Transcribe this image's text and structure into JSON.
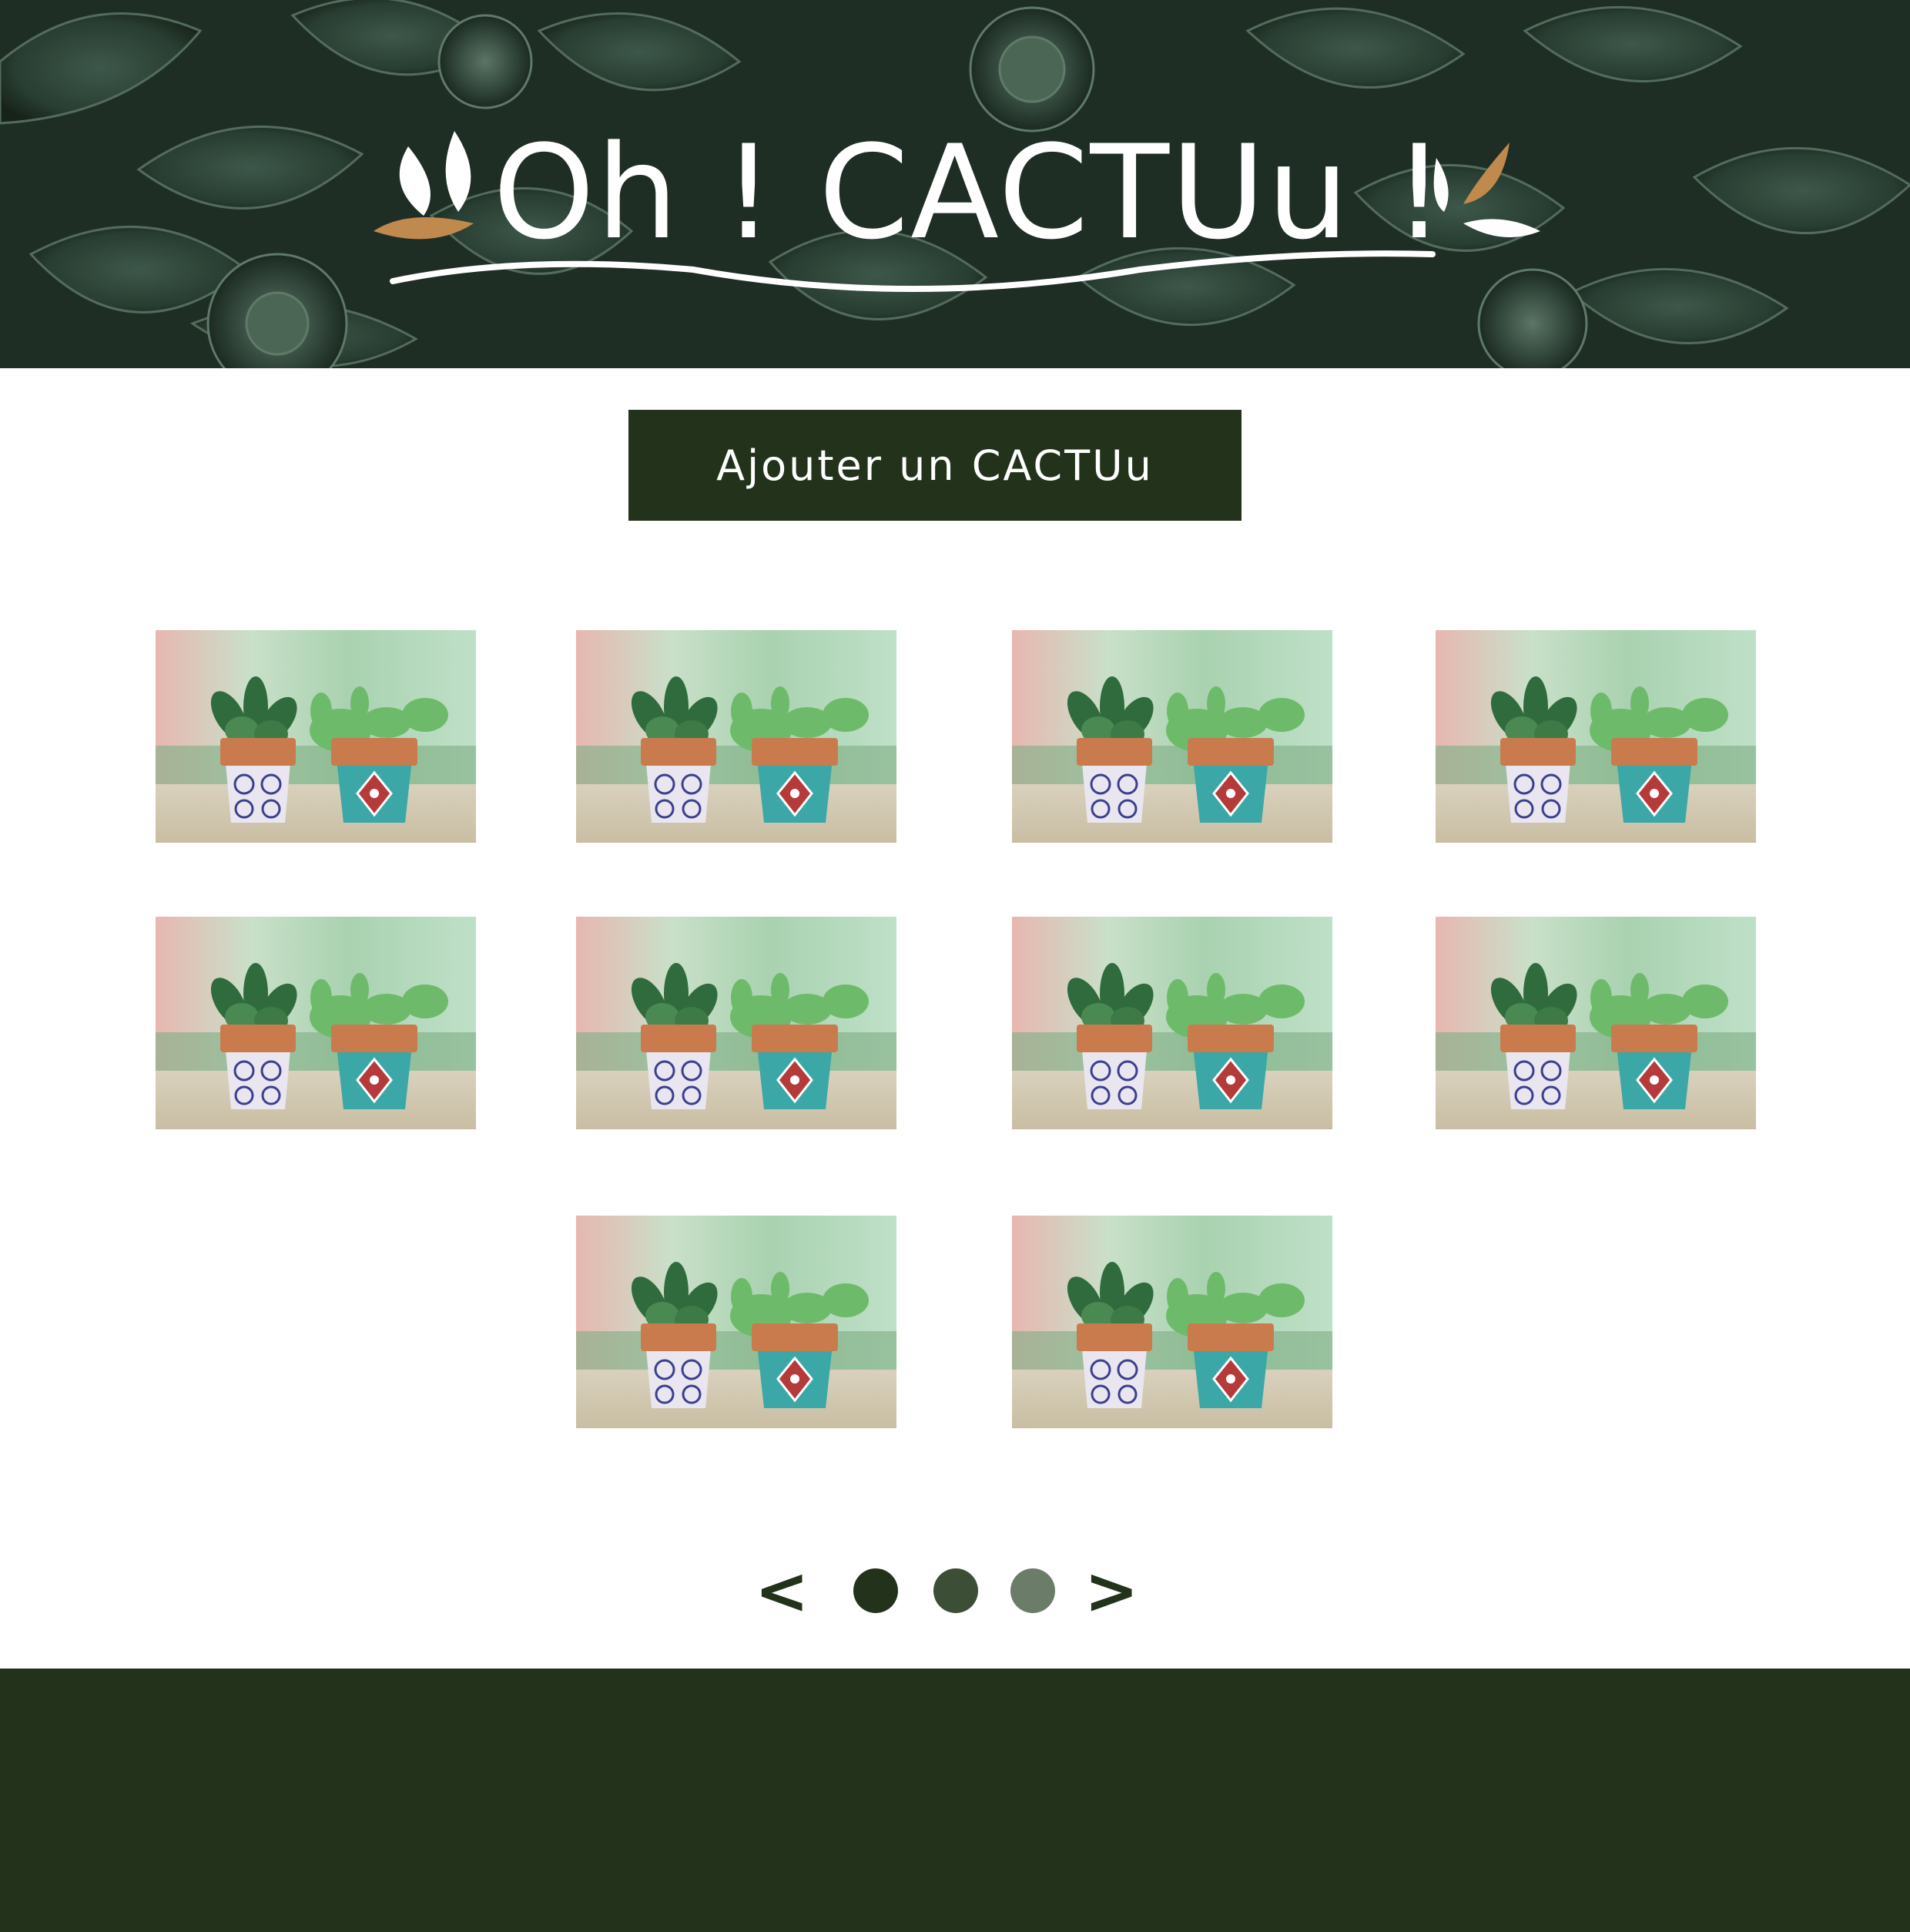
{
  "header": {
    "logo_text": "Oh ! CACTUu !"
  },
  "actions": {
    "add_button_label": "Ajouter un CACTUu"
  },
  "products": [
    {
      "image": "two succulents in patterned ceramic pots"
    },
    {
      "image": "two succulents in patterned ceramic pots"
    },
    {
      "image": "two succulents in patterned ceramic pots"
    },
    {
      "image": "two succulents in patterned ceramic pots"
    },
    {
      "image": "two succulents in patterned ceramic pots"
    },
    {
      "image": "two succulents in patterned ceramic pots"
    },
    {
      "image": "two succulents in patterned ceramic pots"
    },
    {
      "image": "two succulents in patterned ceramic pots"
    },
    {
      "image": "two succulents in patterned ceramic pots"
    },
    {
      "image": "two succulents in patterned ceramic pots"
    }
  ],
  "pagination": {
    "prev_label": "<",
    "next_label": ">",
    "pages": 3,
    "current_page": 1,
    "dot_colors": [
      "#22321b",
      "#3d4e36",
      "#6b7d68"
    ]
  },
  "colors": {
    "brand_dark_green": "#22321b",
    "footer": "#22321b",
    "accent_copper": "#c08a4e",
    "white": "#ffffff"
  },
  "icons": {
    "prev": "chevron-left-icon",
    "next": "chevron-right-icon",
    "logo_leaf": "leaf-icon"
  }
}
